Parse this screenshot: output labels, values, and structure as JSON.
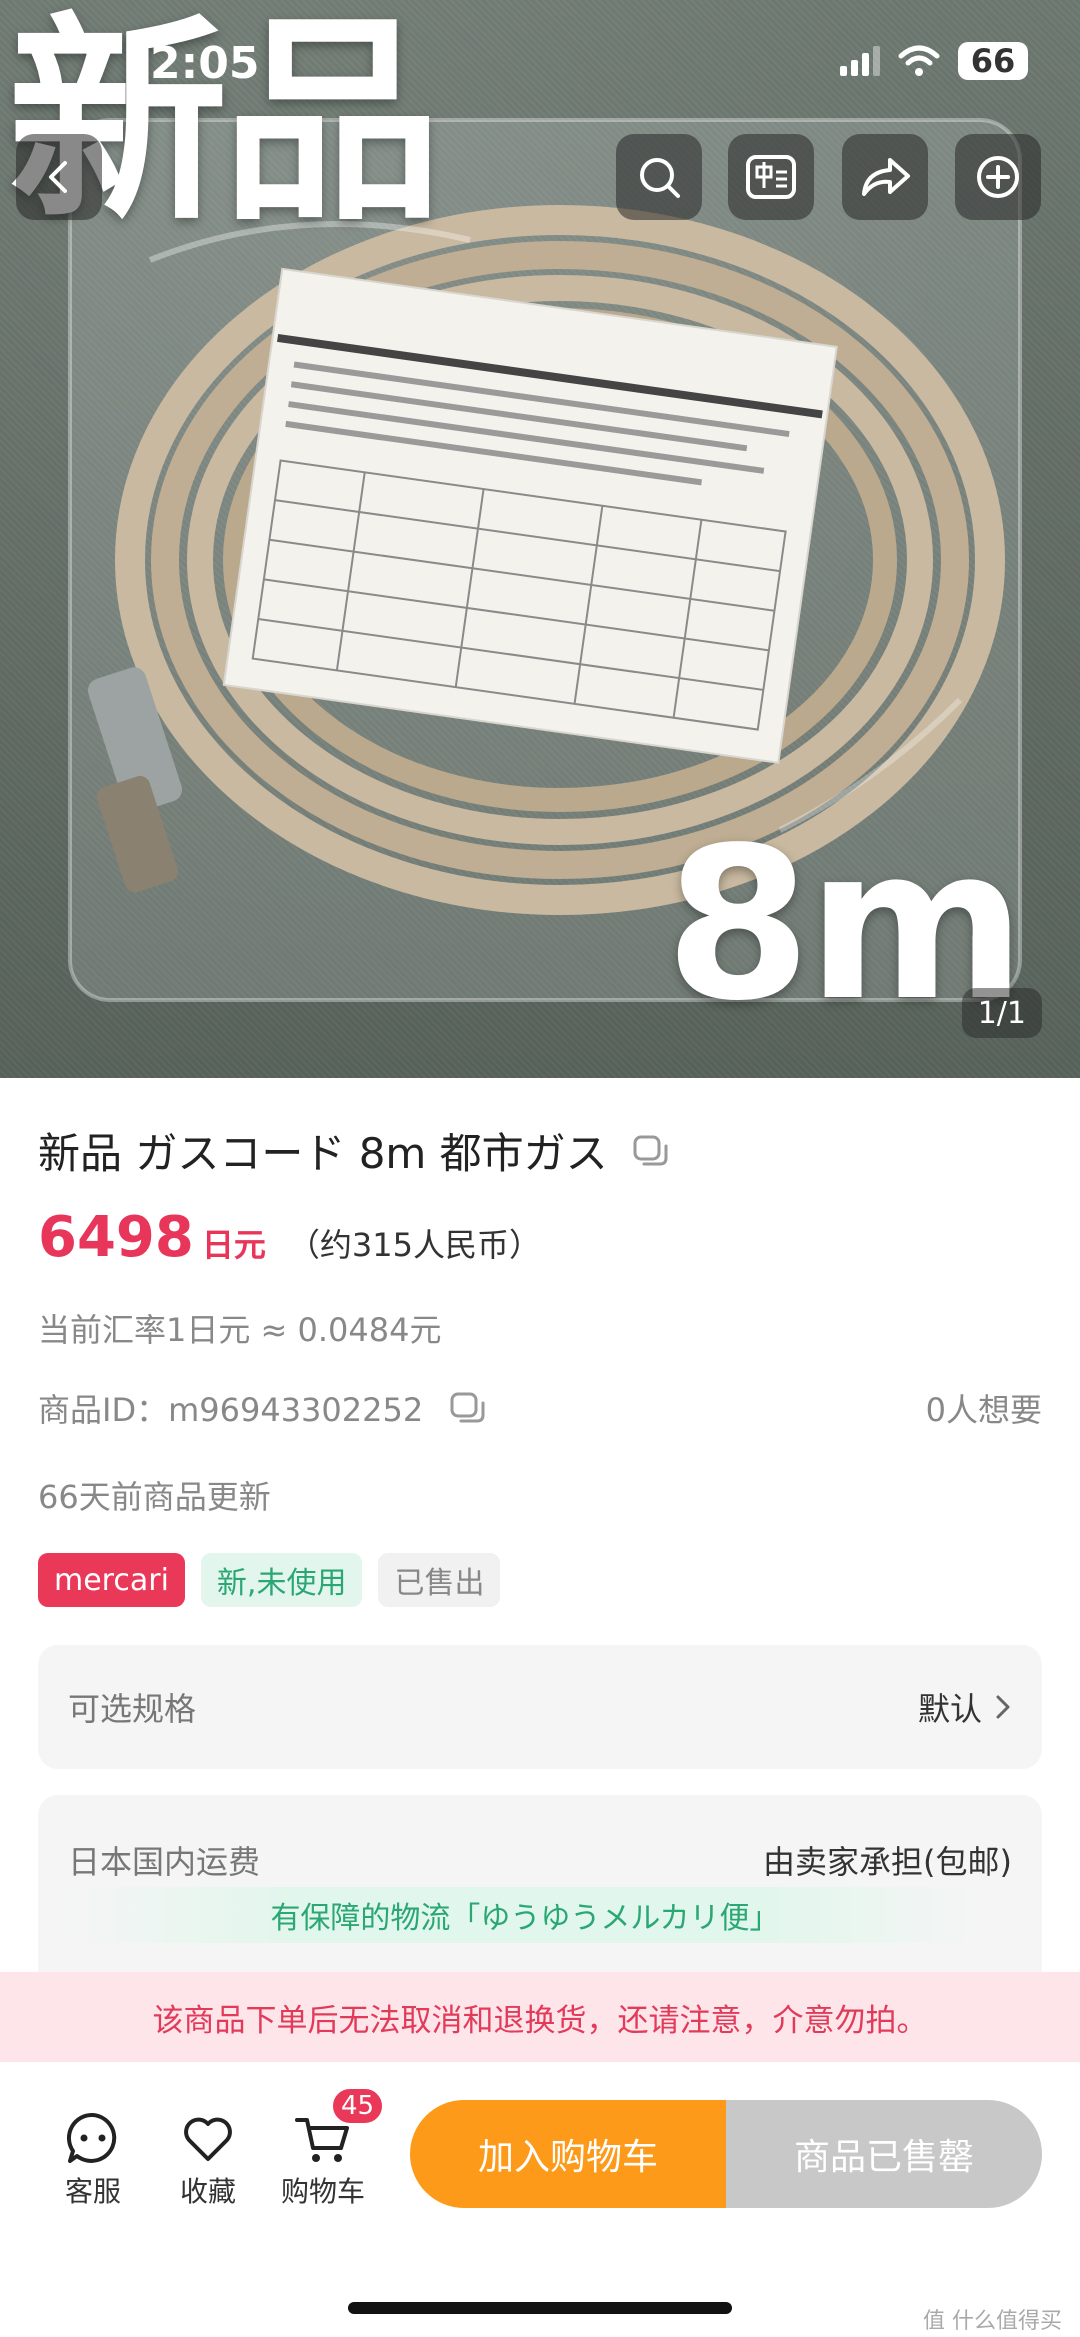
{
  "status_bar": {
    "time": "2:05",
    "battery": "66"
  },
  "hero": {
    "overlay_new": "新品",
    "overlay_length": "8m",
    "image_counter": "1/1"
  },
  "product": {
    "title": "新品 ガスコード 8m 都市ガス",
    "price": "6498",
    "price_unit": "日元",
    "price_cny": "（约315人民币）",
    "exchange_rate": "当前汇率1日元 ≈ 0.0484元",
    "product_id": "商品ID：m96943302252",
    "want_count": "0人想要",
    "updated": "66天前商品更新",
    "tags": {
      "platform": "mercari",
      "condition": "新,未使用",
      "status": "已售出"
    }
  },
  "spec": {
    "label": "可选规格",
    "value": "默认"
  },
  "shipping": {
    "label": "日本国内运费",
    "value": "由卖家承担(包邮)",
    "banner": "有保障的物流「ゆうゆうメルカリ便」"
  },
  "notice": "该商品下单后无法取消和退换货，还请注意，介意勿拍。",
  "bottom_bar": {
    "service": "客服",
    "favorite": "收藏",
    "cart": "购物车",
    "cart_badge": "45",
    "add_to_cart": "加入购物车",
    "sold_out": "商品已售罄"
  },
  "watermark": "值 什么值得买",
  "colors": {
    "accent": "#e8365a",
    "brand_tag": "#ea3859",
    "condition_green": "#2ba774",
    "cart_button": "#fd9a1a",
    "sold_button": "#c8c8c8"
  },
  "icons": [
    "back-icon",
    "search-icon",
    "translate-icon",
    "share-icon",
    "add-icon",
    "copy-icon",
    "chevron-right-icon",
    "chat-icon",
    "heart-icon",
    "cart-icon",
    "signal-icon",
    "wifi-icon"
  ]
}
